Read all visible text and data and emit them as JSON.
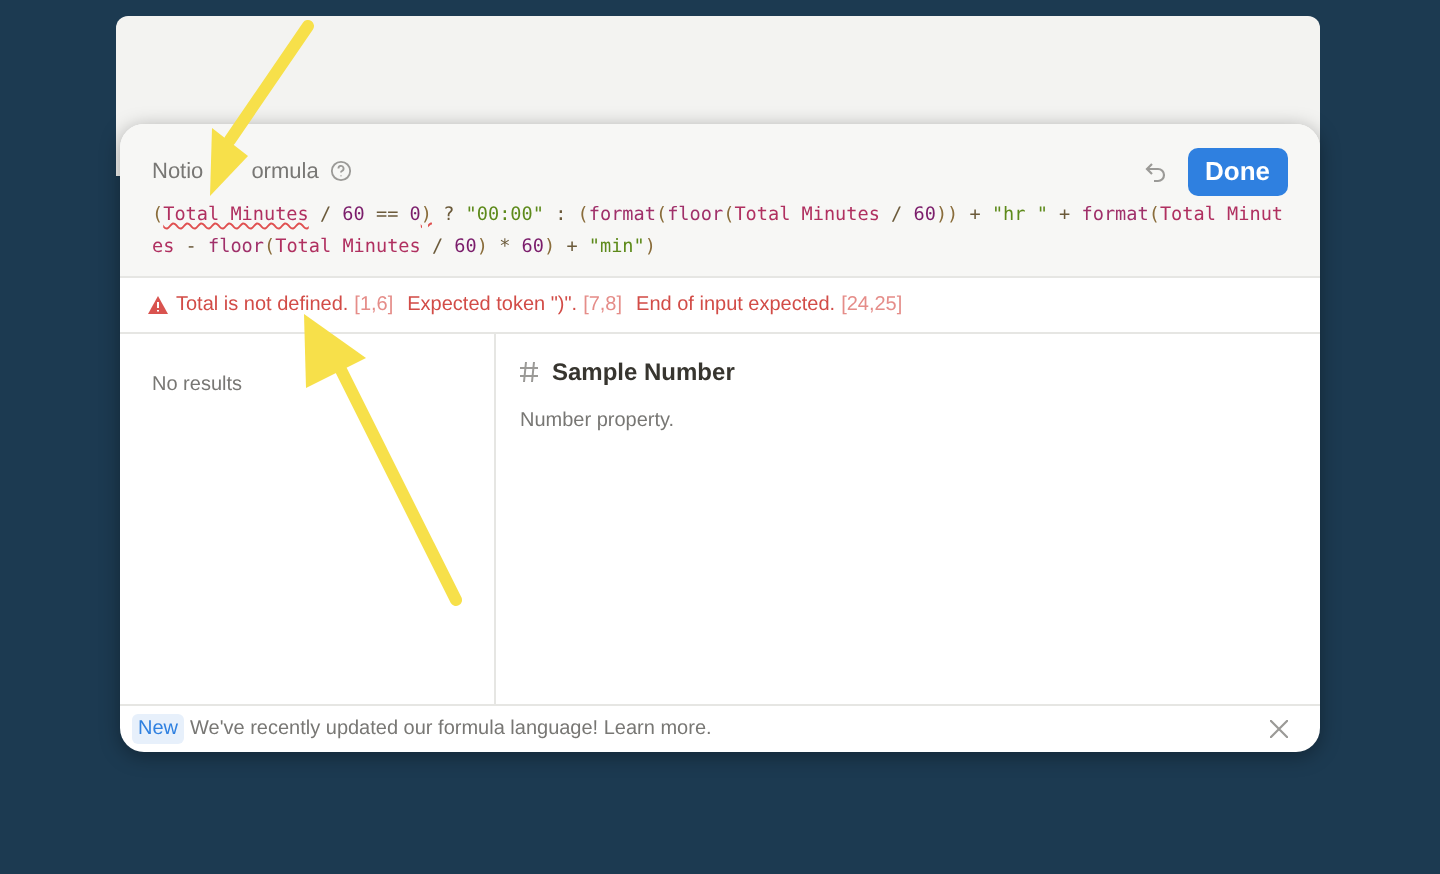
{
  "dialog": {
    "title_parts": [
      "Notio",
      "ormula"
    ],
    "done_button": "Done",
    "formula": [
      {
        "kind": "paren",
        "text": "("
      },
      {
        "kind": "error_prop",
        "text": "Total Minutes"
      },
      {
        "kind": "op",
        "text": " / "
      },
      {
        "kind": "number",
        "text": "60"
      },
      {
        "kind": "op",
        "text": " == "
      },
      {
        "kind": "number",
        "text": "0"
      },
      {
        "kind": "error_paren",
        "text": ")"
      },
      {
        "kind": "op",
        "text": " ? "
      },
      {
        "kind": "string",
        "text": "\"00:00\""
      },
      {
        "kind": "op",
        "text": " : "
      },
      {
        "kind": "paren",
        "text": "("
      },
      {
        "kind": "func",
        "text": "format"
      },
      {
        "kind": "paren",
        "text": "("
      },
      {
        "kind": "func",
        "text": "floor"
      },
      {
        "kind": "paren",
        "text": "("
      },
      {
        "kind": "prop",
        "text": "Total Minutes"
      },
      {
        "kind": "op",
        "text": " / "
      },
      {
        "kind": "number",
        "text": "60"
      },
      {
        "kind": "paren",
        "text": "))"
      },
      {
        "kind": "op",
        "text": " + "
      },
      {
        "kind": "string",
        "text": "\"hr \""
      },
      {
        "kind": "op",
        "text": " + "
      },
      {
        "kind": "func",
        "text": "format"
      },
      {
        "kind": "paren",
        "text": "("
      },
      {
        "kind": "prop",
        "text": "Total Minutes"
      },
      {
        "kind": "op",
        "text": " - "
      },
      {
        "kind": "func",
        "text": "floor"
      },
      {
        "kind": "paren",
        "text": "("
      },
      {
        "kind": "prop",
        "text": "Total Minutes"
      },
      {
        "kind": "op",
        "text": " / "
      },
      {
        "kind": "number",
        "text": "60"
      },
      {
        "kind": "paren",
        "text": ")"
      },
      {
        "kind": "op",
        "text": " * "
      },
      {
        "kind": "number",
        "text": "60"
      },
      {
        "kind": "paren",
        "text": ")"
      },
      {
        "kind": "op",
        "text": " + "
      },
      {
        "kind": "string",
        "text": "\"min\""
      },
      {
        "kind": "paren",
        "text": ")"
      }
    ],
    "errors": [
      {
        "message": "Total is not defined.",
        "range": "[1,6]"
      },
      {
        "message": "Expected token \")\".",
        "range": "[7,8]"
      },
      {
        "message": "End of input expected.",
        "range": "[24,25]"
      }
    ],
    "results": {
      "empty_text": "No results"
    },
    "detail": {
      "title": "Sample Number",
      "description": "Number property."
    },
    "footer": {
      "badge": "New",
      "text": "We've recently updated our formula language! Learn more."
    }
  }
}
